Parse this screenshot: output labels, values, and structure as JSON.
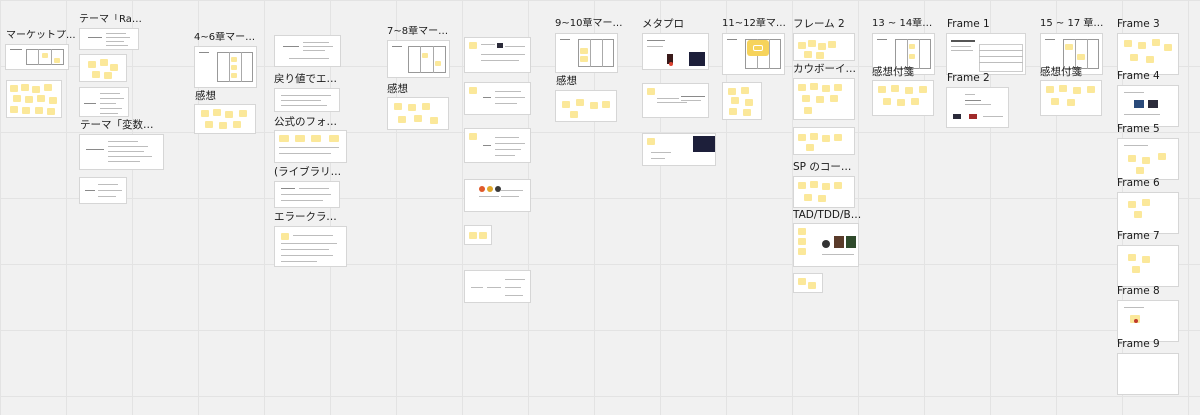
{
  "board": {
    "labels": {
      "market": "マーケットプ...",
      "theme_rati": "テーマ「Rati...",
      "theme_var": "テーマ「変数スコ...",
      "ch4_6": "4~6章マーケ...",
      "kanso1": "感想",
      "return_val": "戻り値でエラ...",
      "official_format": "公式のフォーマ...",
      "library": "(ライブラリ 前...",
      "error_class": "エラークラスの...",
      "ch7_8": "7~8章マーケ...",
      "kanso2": "感想",
      "ch9_10": "9~10章マーケ...",
      "kanso3": "感想",
      "metapro": "メタプロ",
      "ch11_12": "11~12章マー...",
      "frame2_jp": "フレーム 2",
      "cowboy": "カウボーイア...",
      "sp_code": "SP のコード...",
      "tad": "TAD/TDD/BDD",
      "ch13_14": "13 ~ 14章マ...",
      "kanso_fusen1": "感想付箋",
      "frame1": "Frame 1",
      "frame2": "Frame 2",
      "ch15_17": "15 ~ 17 章マ...",
      "kanso_fusen2": "感想付箋",
      "frame3": "Frame 3",
      "frame4": "Frame 4",
      "frame5": "Frame 5",
      "frame6": "Frame 6",
      "frame7": "Frame 7",
      "frame8": "Frame 8",
      "frame9": "Frame 9"
    },
    "colors": {
      "canvas": "#f1f1f1",
      "grid": "#e3e3e3",
      "sticky": "#fbe89a",
      "frame_border": "#d6d6d6",
      "accent_yellow": "#f6d35b",
      "dark_image": "#2b2b3a"
    },
    "icons": {
      "chat_bubble": "chat-bubble-icon"
    }
  }
}
